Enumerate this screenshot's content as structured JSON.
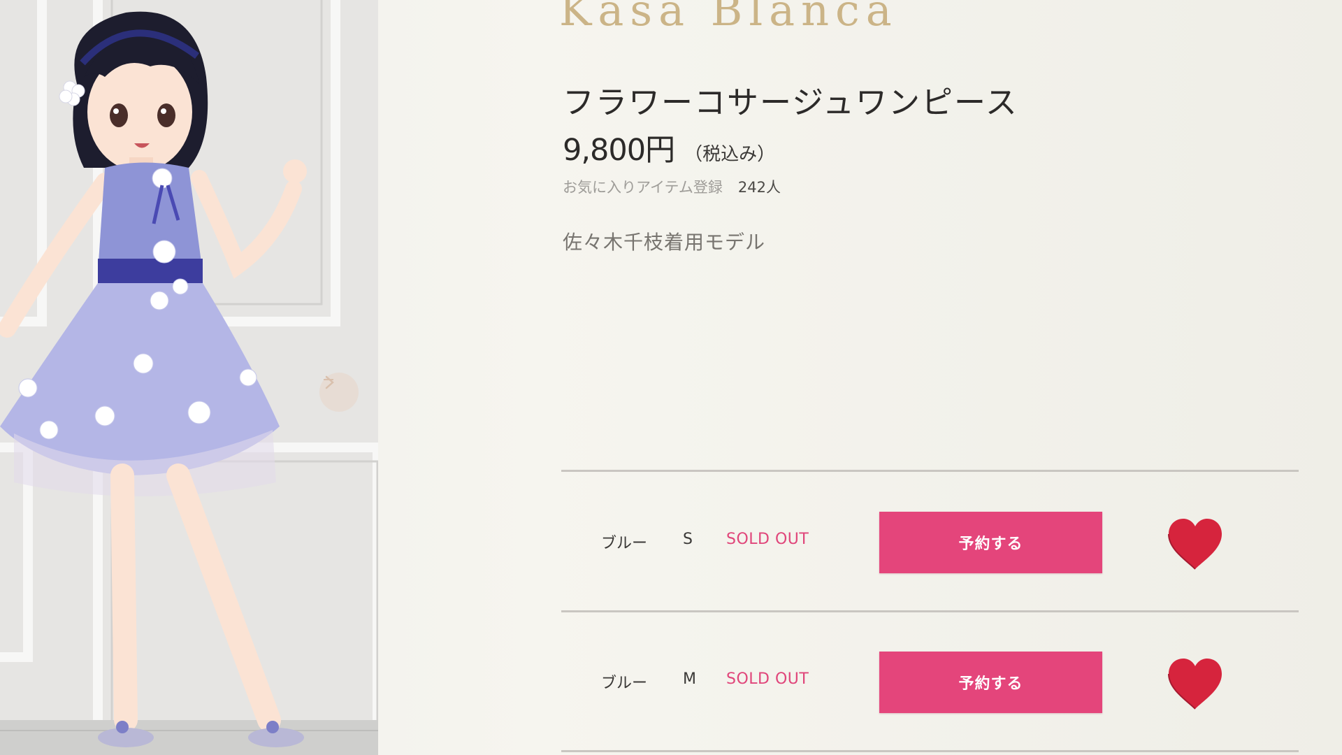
{
  "brand": {
    "name": "Kasa Blanca"
  },
  "product": {
    "title": "フラワーコサージュワンピース",
    "price": "9,800円",
    "tax_note": "（税込み）",
    "favorite_label": "お気に入りアイテム登録",
    "favorite_count": "242人",
    "model_note": "佐々木千枝着用モデル"
  },
  "variants": [
    {
      "color": "ブルー",
      "size": "S",
      "stock_status": "SOLD OUT",
      "reserve_label": "予約する"
    },
    {
      "color": "ブルー",
      "size": "M",
      "stock_status": "SOLD OUT",
      "reserve_label": "予約する"
    }
  ],
  "colors": {
    "brand_gold": "#cbb487",
    "accent_pink": "#e4457b",
    "sold_out_pink": "#e0457a",
    "heart_red": "#d6243d",
    "dress_blue": "#8e94d6"
  },
  "icons": {
    "carousel_next": "chevron-right-icon",
    "favorite": "heart-icon"
  }
}
